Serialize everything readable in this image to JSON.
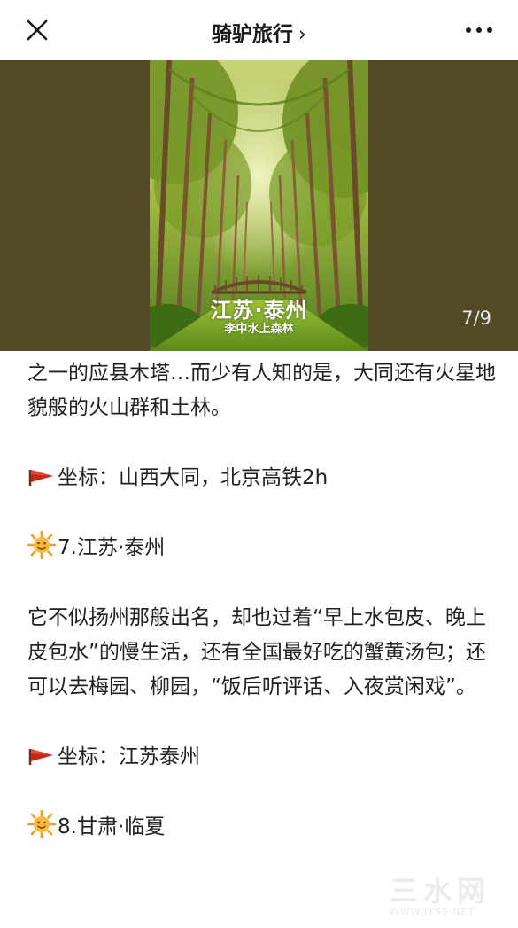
{
  "header": {
    "title": "骑驴旅行",
    "title_chevron": "›",
    "close_icon": "close-icon",
    "more_icon": "more-icon"
  },
  "media": {
    "photo_title": "江苏·泰州",
    "photo_subtitle": "李中水上森林",
    "counter": "7/9",
    "background_color": "#524a25"
  },
  "article": {
    "para_intro": "之一的应县木塔…而少有人知的是，大同还有火星地貌般的火山群和土林。",
    "coord_1": "坐标：山西大同，北京高铁2h",
    "heading_7": "7.江苏·泰州",
    "para_taizhou": "它不似扬州那般出名，却也过着“早上水包皮、晚上皮包水”的慢生活，还有全国最好吃的蟹黄汤包；还可以去梅园、柳园，“饭后听评话、入夜赏闲戏”。",
    "coord_2": "坐标：江苏泰州",
    "heading_8": "8.甘肃·临夏",
    "flag_icon": "red-flag-icon",
    "sun_icon": "smiling-sun-icon"
  },
  "watermark": {
    "text": "三水网",
    "url": "WWW.JYSS.NET"
  }
}
